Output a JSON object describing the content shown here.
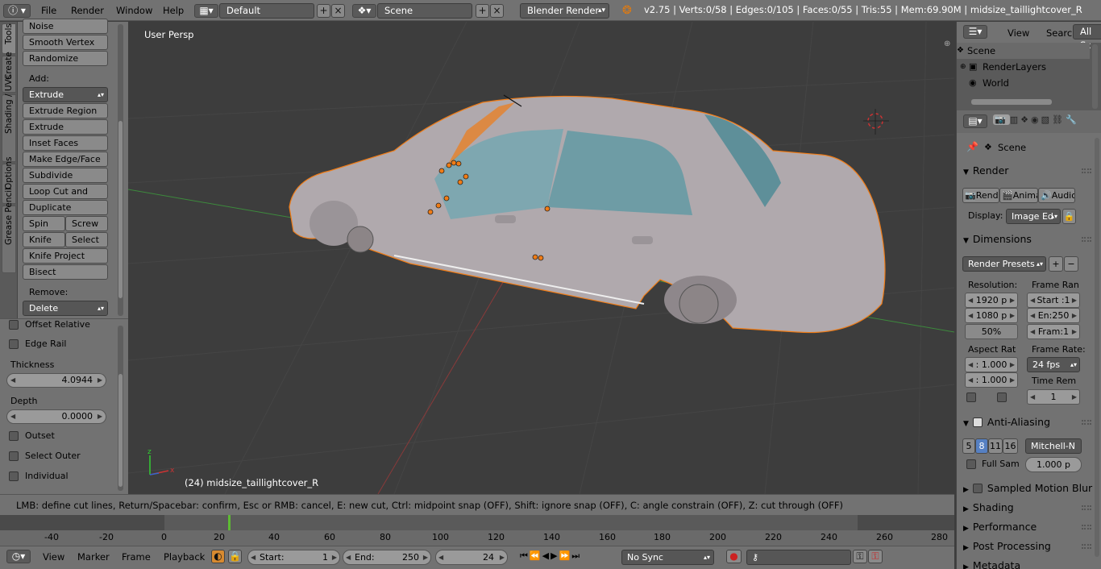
{
  "topbar": {
    "menu": [
      "File",
      "Render",
      "Window",
      "Help"
    ],
    "layout": "Default",
    "scene": "Scene",
    "engine": "Blender Render",
    "stats": "v2.75 | Verts:0/58 | Edges:0/105 | Faces:0/55 | Tris:55 | Mem:69.90M | midsize_taillightcover_R"
  },
  "tabs": [
    "Tools",
    "Create",
    "Shading / UVs",
    "Options",
    "Grease Pencil"
  ],
  "shelf": {
    "noise": "Noise",
    "smooth_vertex": "Smooth Vertex",
    "randomize": "Randomize",
    "add_label": "Add:",
    "extrude": "Extrude",
    "extrude_region": "Extrude Region",
    "extrude_individual": "Extrude Individual",
    "inset_faces": "Inset Faces",
    "make_edge_face": "Make Edge/Face",
    "subdivide": "Subdivide",
    "loop_cut": "Loop Cut and Slide",
    "duplicate": "Duplicate",
    "spin": "Spin",
    "screw": "Screw",
    "knife": "Knife",
    "select": "Select",
    "knife_project": "Knife Project",
    "bisect": "Bisect",
    "remove_label": "Remove:",
    "delete": "Delete"
  },
  "operator": {
    "offset_relative": "Offset Relative",
    "edge_rail": "Edge Rail",
    "thickness_label": "Thickness",
    "thickness_value": "4.0944",
    "depth_label": "Depth",
    "depth_value": "0.0000",
    "outset": "Outset",
    "select_outer": "Select Outer",
    "individual": "Individual"
  },
  "viewport": {
    "view_label": "User Persp",
    "object_label": "(24) midsize_taillightcover_R"
  },
  "status": "LMB: define cut lines, Return/Spacebar: confirm, Esc or RMB: cancel, E: new cut, Ctrl: midpoint snap (OFF), Shift: ignore snap (OFF), C: angle constrain (OFF), Z: cut through (OFF)",
  "timeline": {
    "ticks": [
      "-40",
      "-20",
      "0",
      "20",
      "40",
      "60",
      "80",
      "100",
      "120",
      "140",
      "160",
      "180",
      "200",
      "220",
      "240",
      "260",
      "280"
    ],
    "menu": [
      "View",
      "Marker",
      "Frame",
      "Playback"
    ],
    "start_label": "Start:",
    "start_value": "1",
    "end_label": "End:",
    "end_value": "250",
    "current": "24",
    "sync": "No Sync"
  },
  "outliner": {
    "menu_view": "View",
    "menu_search": "Search",
    "filter": "All Sc",
    "rows": [
      "Scene",
      "RenderLayers",
      "World"
    ]
  },
  "props": {
    "context": "Scene",
    "render_header": "Render",
    "render_btn": "Rende",
    "anim_btn": "Anima",
    "audio_btn": "Audio",
    "display_label": "Display:",
    "display_value": "Image Ed",
    "dimensions_header": "Dimensions",
    "presets": "Render Presets",
    "resolution_label": "Resolution:",
    "res_x": "1920 p",
    "res_y": "1080 p",
    "res_pct": "50%",
    "frame_range_label": "Frame Ran",
    "frame_start": "Start :1",
    "frame_end": "En:250",
    "frame_step": "Fram:1",
    "aspect_label": "Aspect Rat",
    "aspect_x": ": 1.000",
    "aspect_y": ": 1.000",
    "framerate_label": "Frame Rate:",
    "fps": "24 fps",
    "time_remap": "Time Rem",
    "time_val": "1",
    "aa_header": "Anti-Aliasing",
    "aa_samples": [
      "5",
      "8",
      "11",
      "16"
    ],
    "aa_filter": "Mitchell-N",
    "full_sample": "Full Sam",
    "filter_size": "1.000 p",
    "motion_blur": "Sampled Motion Blur",
    "shading": "Shading",
    "performance": "Performance",
    "post_processing": "Post Processing",
    "metadata": "Metadata"
  },
  "colors": {
    "selection": "#f07c16",
    "active_sample": "#5680c2",
    "grid_x": "#8a3a3a",
    "grid_y": "#3d8a3d"
  }
}
